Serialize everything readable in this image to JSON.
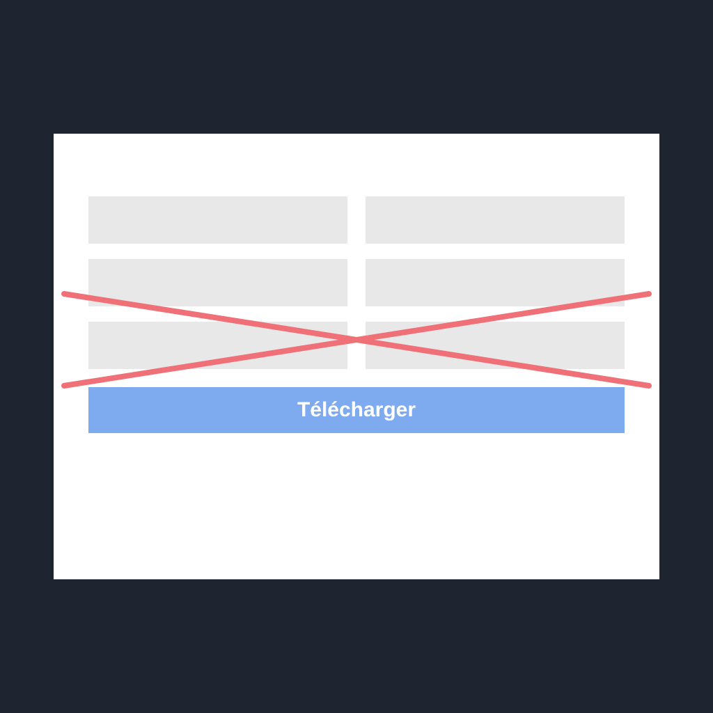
{
  "colors": {
    "background": "#1e2530",
    "card": "#ffffff",
    "field": "#e8e8e8",
    "button": "#7eaaf0",
    "cross": "#f07077"
  },
  "form": {
    "fields": [
      {
        "row": 1,
        "col": 1
      },
      {
        "row": 1,
        "col": 2
      },
      {
        "row": 2,
        "col": 1
      },
      {
        "row": 2,
        "col": 2
      },
      {
        "row": 3,
        "col": 1
      },
      {
        "row": 3,
        "col": 2
      }
    ]
  },
  "button": {
    "download_label": "Télécharger"
  }
}
